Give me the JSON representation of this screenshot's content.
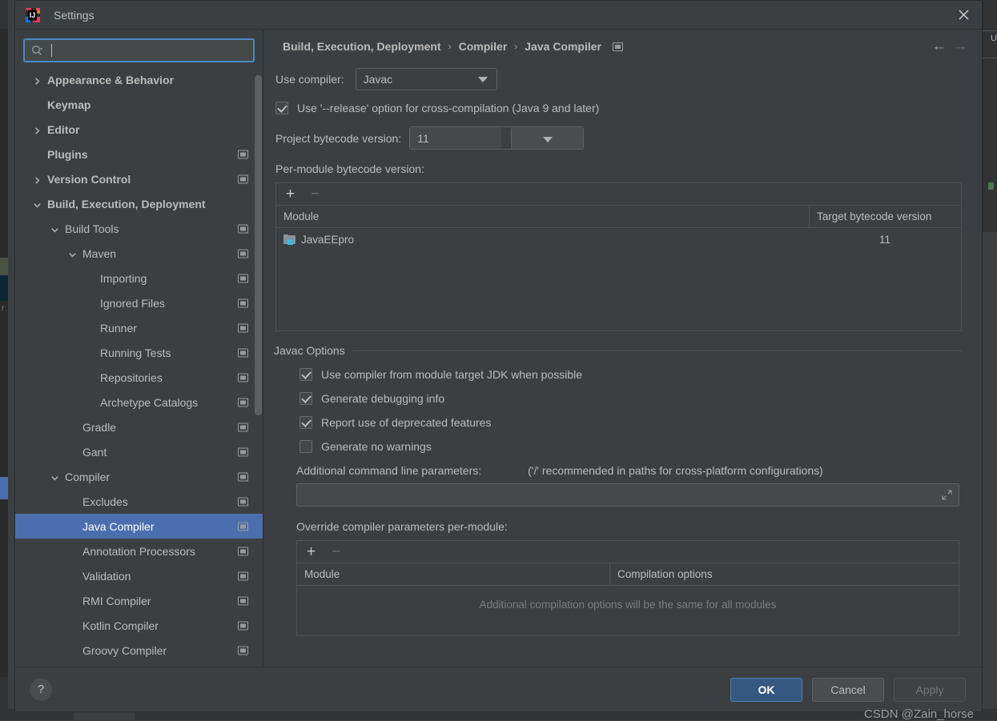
{
  "window": {
    "title": "Settings",
    "logo_icon": "intellij-idea-logo",
    "close_icon": "close-icon"
  },
  "search": {
    "icon": "search-icon",
    "value": "",
    "placeholder": ""
  },
  "sidebar": {
    "items": [
      {
        "label": "Appearance & Behavior",
        "indent": 0,
        "arrow": "collapsed",
        "bold": true,
        "project_icon": false,
        "selected": false
      },
      {
        "label": "Keymap",
        "indent": 0,
        "arrow": "none",
        "bold": true,
        "project_icon": false,
        "selected": false
      },
      {
        "label": "Editor",
        "indent": 0,
        "arrow": "collapsed",
        "bold": true,
        "project_icon": false,
        "selected": false
      },
      {
        "label": "Plugins",
        "indent": 0,
        "arrow": "none",
        "bold": true,
        "project_icon": true,
        "selected": false
      },
      {
        "label": "Version Control",
        "indent": 0,
        "arrow": "collapsed",
        "bold": true,
        "project_icon": true,
        "selected": false
      },
      {
        "label": "Build, Execution, Deployment",
        "indent": 0,
        "arrow": "expanded",
        "bold": true,
        "project_icon": false,
        "selected": false
      },
      {
        "label": "Build Tools",
        "indent": 1,
        "arrow": "expanded",
        "bold": false,
        "project_icon": true,
        "selected": false
      },
      {
        "label": "Maven",
        "indent": 2,
        "arrow": "expanded",
        "bold": false,
        "project_icon": true,
        "selected": false
      },
      {
        "label": "Importing",
        "indent": 3,
        "arrow": "none",
        "bold": false,
        "project_icon": true,
        "selected": false
      },
      {
        "label": "Ignored Files",
        "indent": 3,
        "arrow": "none",
        "bold": false,
        "project_icon": true,
        "selected": false
      },
      {
        "label": "Runner",
        "indent": 3,
        "arrow": "none",
        "bold": false,
        "project_icon": true,
        "selected": false
      },
      {
        "label": "Running Tests",
        "indent": 3,
        "arrow": "none",
        "bold": false,
        "project_icon": true,
        "selected": false
      },
      {
        "label": "Repositories",
        "indent": 3,
        "arrow": "none",
        "bold": false,
        "project_icon": true,
        "selected": false
      },
      {
        "label": "Archetype Catalogs",
        "indent": 3,
        "arrow": "none",
        "bold": false,
        "project_icon": true,
        "selected": false
      },
      {
        "label": "Gradle",
        "indent": 2,
        "arrow": "none",
        "bold": false,
        "project_icon": true,
        "selected": false
      },
      {
        "label": "Gant",
        "indent": 2,
        "arrow": "none",
        "bold": false,
        "project_icon": true,
        "selected": false
      },
      {
        "label": "Compiler",
        "indent": 1,
        "arrow": "expanded",
        "bold": false,
        "project_icon": true,
        "selected": false
      },
      {
        "label": "Excludes",
        "indent": 2,
        "arrow": "none",
        "bold": false,
        "project_icon": true,
        "selected": false
      },
      {
        "label": "Java Compiler",
        "indent": 2,
        "arrow": "none",
        "bold": false,
        "project_icon": true,
        "selected": true
      },
      {
        "label": "Annotation Processors",
        "indent": 2,
        "arrow": "none",
        "bold": false,
        "project_icon": true,
        "selected": false
      },
      {
        "label": "Validation",
        "indent": 2,
        "arrow": "none",
        "bold": false,
        "project_icon": true,
        "selected": false
      },
      {
        "label": "RMI Compiler",
        "indent": 2,
        "arrow": "none",
        "bold": false,
        "project_icon": true,
        "selected": false
      },
      {
        "label": "Kotlin Compiler",
        "indent": 2,
        "arrow": "none",
        "bold": false,
        "project_icon": true,
        "selected": false
      },
      {
        "label": "Groovy Compiler",
        "indent": 2,
        "arrow": "none",
        "bold": false,
        "project_icon": true,
        "selected": false
      }
    ]
  },
  "breadcrumb": {
    "parts": [
      "Build, Execution, Deployment",
      "Compiler",
      "Java Compiler"
    ],
    "separator": "›",
    "trailing_icon": "project-settings-icon",
    "back_icon": "←",
    "forward_icon": "→"
  },
  "main": {
    "use_compiler_label": "Use compiler:",
    "use_compiler_value": "Javac",
    "release_option": {
      "label": "Use '--release' option for cross-compilation (Java 9 and later)",
      "checked": true
    },
    "project_bytecode_label": "Project bytecode version:",
    "project_bytecode_value": "11",
    "per_module_label": "Per-module bytecode version:",
    "module_table": {
      "add_icon": "+",
      "remove_icon": "−",
      "columns": [
        "Module",
        "Target bytecode version"
      ],
      "rows": [
        {
          "module": "JavaEEpro",
          "icon": "module-folder-icon",
          "version": "11"
        }
      ]
    },
    "javac_group_title": "Javac Options",
    "javac_options": [
      {
        "label": "Use compiler from module target JDK when possible",
        "checked": true
      },
      {
        "label": "Generate debugging info",
        "checked": true
      },
      {
        "label": "Report use of deprecated features",
        "checked": true
      },
      {
        "label": "Generate no warnings",
        "checked": false
      }
    ],
    "additional_params_label": "Additional command line parameters:",
    "additional_params_hint": "('/' recommended in paths for cross-platform configurations)",
    "additional_params_value": "",
    "expand_icon": "expand-field-icon",
    "override_label": "Override compiler parameters per-module:",
    "override_table": {
      "add_icon": "+",
      "remove_icon": "−",
      "columns": [
        "Module",
        "Compilation options"
      ],
      "empty_text": "Additional compilation options will be the same for all modules"
    }
  },
  "footer": {
    "help_icon": "?",
    "ok_label": "OK",
    "cancel_label": "Cancel",
    "apply_label": "Apply"
  },
  "watermark": "CSDN @Zain_horse",
  "colors": {
    "accent_blue": "#4b6eaf",
    "primary_button": "#365880",
    "focus_ring": "#4a88c7",
    "background": "#3c3f41",
    "text": "#bbbbbb"
  }
}
